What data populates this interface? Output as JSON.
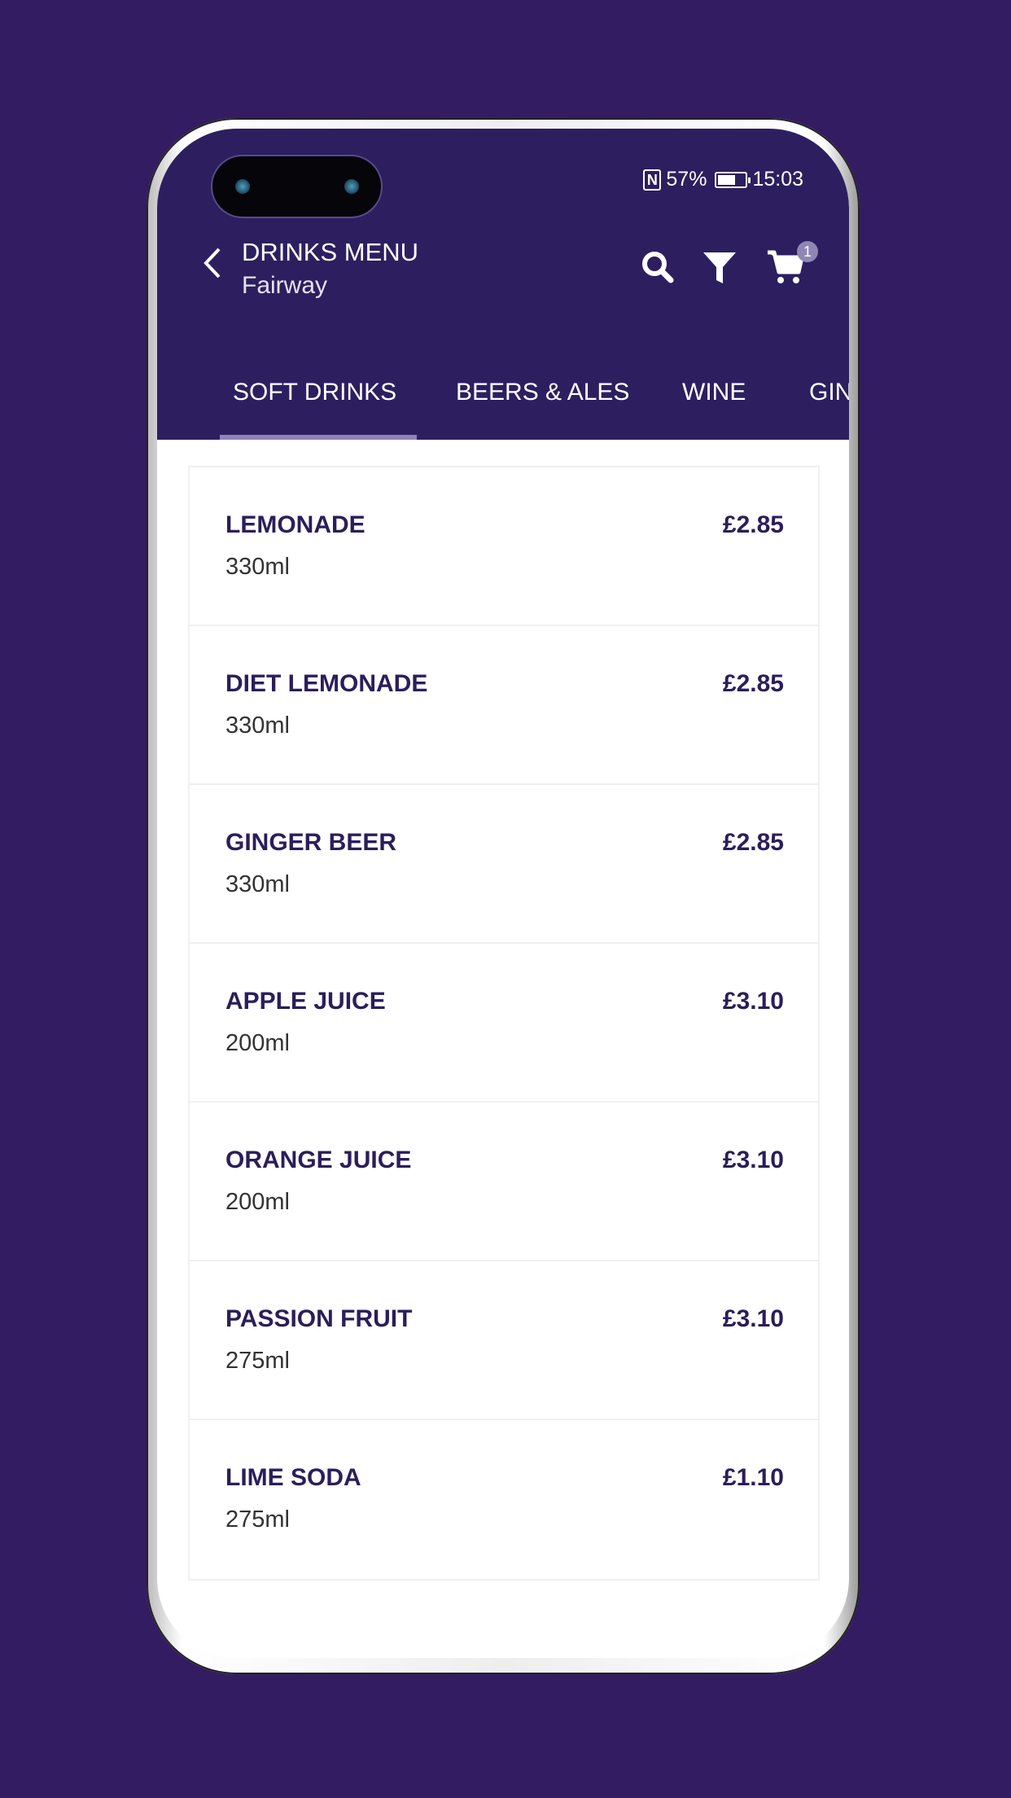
{
  "status_bar": {
    "battery": "57%",
    "battery_level": 0.57,
    "time": "15:03",
    "nfc": "N"
  },
  "header": {
    "title": "DRINKS MENU",
    "subtitle": "Fairway",
    "cart_count": "1",
    "icons": [
      "back-chevron-icon",
      "search-icon",
      "filter-icon",
      "cart-icon"
    ]
  },
  "tabs": [
    {
      "label": "SOFT DRINKS",
      "active": true
    },
    {
      "label": "BEERS & ALES"
    },
    {
      "label": "WINE"
    },
    {
      "label": "GIN"
    }
  ],
  "items": [
    {
      "name": "LEMONADE",
      "size": "330ml",
      "price": "£2.85"
    },
    {
      "name": "DIET LEMONADE",
      "size": "330ml",
      "price": "£2.85"
    },
    {
      "name": "GINGER BEER",
      "size": "330ml",
      "price": "£2.85"
    },
    {
      "name": "APPLE JUICE",
      "size": "200ml",
      "price": "£3.10"
    },
    {
      "name": "ORANGE JUICE",
      "size": "200ml",
      "price": "£3.10"
    },
    {
      "name": "PASSION FRUIT",
      "size": "275ml",
      "price": "£3.10"
    },
    {
      "name": "LIME SODA",
      "size": "275ml",
      "price": "£1.10"
    }
  ],
  "colors": {
    "background": "#331c62",
    "header": "#2d1f5f",
    "text": "#2b1e5a",
    "tab_indicator": "#8d83b8"
  }
}
